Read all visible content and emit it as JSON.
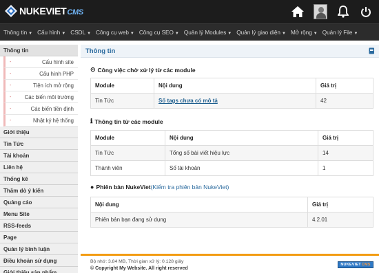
{
  "header": {
    "logo_main": "NUKEVIET",
    "logo_suffix": "CMS",
    "icons": [
      "home-icon",
      "user-avatar",
      "bell-icon",
      "power-icon"
    ]
  },
  "nav": [
    {
      "label": "Thông tin"
    },
    {
      "label": "Cấu hình"
    },
    {
      "label": "CSDL"
    },
    {
      "label": "Công cụ web"
    },
    {
      "label": "Công cụ SEO"
    },
    {
      "label": "Quản lý Modules"
    },
    {
      "label": "Quản lý giao diện"
    },
    {
      "label": "Mở rộng"
    },
    {
      "label": "Quản lý File"
    }
  ],
  "sidebar": {
    "active": "Thông tin",
    "subitems": [
      "Cấu hình site",
      "Cấu hình PHP",
      "Tiện ích mở rộng",
      "Các biến môi trường",
      "Các biến tiền định",
      "Nhật ký hệ thống"
    ],
    "items": [
      "Giới thiệu",
      "Tin Tức",
      "Tài khoản",
      "Liên hệ",
      "Thống kê",
      "Thăm dò ý kiến",
      "Quảng cáo",
      "Menu Site",
      "RSS-feeds",
      "Page",
      "Quản lý bình luận",
      "Điều khoản sử dụng",
      "Giới thiệu sản phẩm"
    ]
  },
  "page": {
    "title": "Thông tin",
    "section1": {
      "title": "Công việc chờ xử lý từ các module",
      "headers": [
        "Module",
        "Nội dung",
        "Giá trị"
      ],
      "rows": [
        [
          "Tin Tức",
          "Số tags chưa có mô tả",
          "42"
        ]
      ]
    },
    "section2": {
      "title": "Thông tin từ các module",
      "headers": [
        "Module",
        "Nội dung",
        "Giá trị"
      ],
      "rows": [
        [
          "Tin Tức",
          "Tổng số bài viết hiệu lực",
          "14"
        ],
        [
          "Thành viên",
          "Số tài khoản",
          "1"
        ]
      ]
    },
    "section3": {
      "title": "Phiên bản NukeViet",
      "link": "(Kiểm tra phiên bản NukeViet)",
      "headers": [
        "Nội dung",
        "Giá trị"
      ],
      "rows": [
        [
          "Phiên bản bạn đang sử dụng",
          "4.2.01"
        ]
      ]
    }
  },
  "footer": {
    "stats": "Bộ nhớ: 3.84 MB, Thời gian xử lý: 0.128 giây",
    "copyright": "© Copyright My Website. All right reserved",
    "badge_main": "NUKEVIET",
    "badge_suffix": "CMS"
  },
  "colors": {
    "header_bg": "#1c1c1c",
    "nav_bg": "#2c2c2c",
    "accent_blue": "#2a6a9e",
    "footer_border": "#f39c12"
  }
}
